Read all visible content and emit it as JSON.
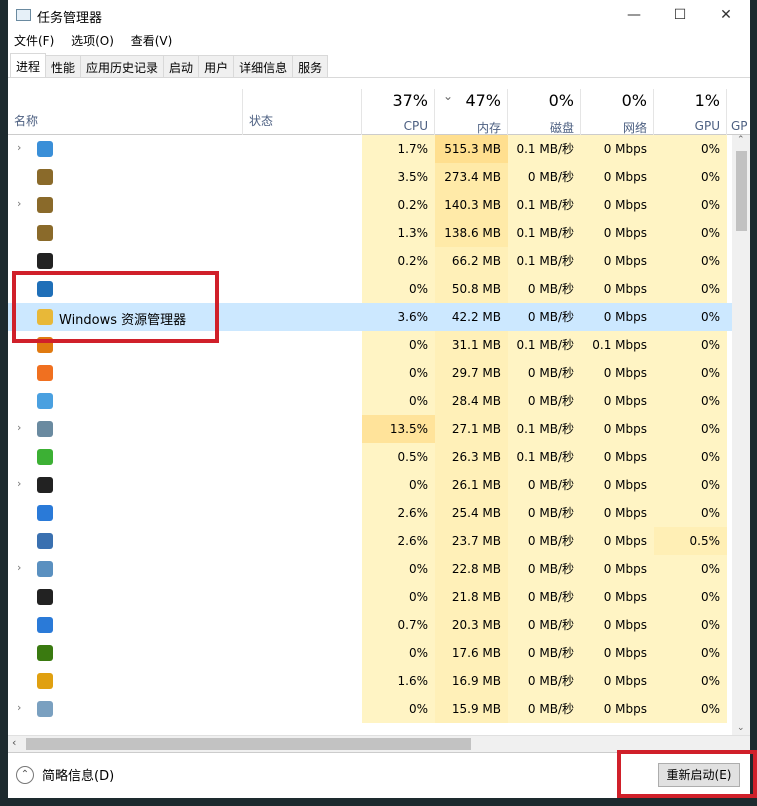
{
  "window": {
    "title": "任务管理器",
    "minimize": "—",
    "maximize": "☐",
    "close": "✕"
  },
  "menu": [
    "文件(F)",
    "选项(O)",
    "查看(V)"
  ],
  "tabs": [
    "进程",
    "性能",
    "应用历史记录",
    "启动",
    "用户",
    "详细信息",
    "服务"
  ],
  "active_tab": 0,
  "columns": {
    "name": "名称",
    "status": "状态",
    "cpu": {
      "pct": "37%",
      "label": "CPU"
    },
    "mem": {
      "pct": "47%",
      "label": "内存",
      "sorted": "⌄"
    },
    "disk": {
      "pct": "0%",
      "label": "磁盘"
    },
    "net": {
      "pct": "0%",
      "label": "网络"
    },
    "gpu": {
      "pct": "1%",
      "label": "GPU"
    },
    "gpu_engine": "GP"
  },
  "rows": [
    {
      "expand": true,
      "icon": "browser-cloud-icon",
      "color": "#3a8fd8",
      "name": "",
      "v": [
        "1.7%",
        "515.3 MB",
        "0.1 MB/秒",
        "0 Mbps",
        "0%"
      ]
    },
    {
      "expand": false,
      "icon": "league-of-legends-icon",
      "color": "#8a6a2a",
      "name": "",
      "v": [
        "3.5%",
        "273.4 MB",
        "0 MB/秒",
        "0 Mbps",
        "0%"
      ]
    },
    {
      "expand": true,
      "icon": "league-of-legends-icon",
      "color": "#8a6a2a",
      "name": "",
      "v": [
        "0.2%",
        "140.3 MB",
        "0.1 MB/秒",
        "0 Mbps",
        "0%"
      ]
    },
    {
      "expand": false,
      "icon": "league-of-legends-icon",
      "color": "#8a6a2a",
      "name": "",
      "v": [
        "1.3%",
        "138.6 MB",
        "0.1 MB/秒",
        "0 Mbps",
        "0%"
      ]
    },
    {
      "expand": false,
      "icon": "qq-penguin-icon",
      "color": "#222222",
      "name": "",
      "v": [
        "0.2%",
        "66.2 MB",
        "0.1 MB/秒",
        "0 Mbps",
        "0%"
      ]
    },
    {
      "expand": false,
      "icon": "tp-icon",
      "color": "#1f6fb8",
      "name": "",
      "v": [
        "0%",
        "50.8 MB",
        "0 MB/秒",
        "0 Mbps",
        "0%"
      ]
    },
    {
      "expand": false,
      "icon": "folder-explorer-icon",
      "color": "#e8b838",
      "name": "Windows 资源管理器",
      "selected": true,
      "v": [
        "3.6%",
        "42.2 MB",
        "0 MB/秒",
        "0 Mbps",
        "0%"
      ]
    },
    {
      "expand": false,
      "icon": "orange-c-icon",
      "color": "#e07a10",
      "name": "",
      "v": [
        "0%",
        "31.1 MB",
        "0.1 MB/秒",
        "0.1 Mbps",
        "0%"
      ]
    },
    {
      "expand": false,
      "icon": "orange-g-icon",
      "color": "#f07020",
      "name": "",
      "v": [
        "0%",
        "29.7 MB",
        "0 MB/秒",
        "0 Mbps",
        "0%"
      ]
    },
    {
      "expand": false,
      "icon": "qt-icon",
      "color": "#4aa0e0",
      "name": "",
      "v": [
        "0%",
        "28.4 MB",
        "0 MB/秒",
        "0 Mbps",
        "0%"
      ]
    },
    {
      "expand": true,
      "icon": "monitor-icon",
      "color": "#6a8aa0",
      "name": "",
      "v": [
        "13.5%",
        "27.1 MB",
        "0.1 MB/秒",
        "0 Mbps",
        "0%"
      ]
    },
    {
      "expand": false,
      "icon": "wechat-icon",
      "color": "#3cb034",
      "name": "",
      "v": [
        "0.5%",
        "26.3 MB",
        "0.1 MB/秒",
        "0 Mbps",
        "0%"
      ]
    },
    {
      "expand": true,
      "icon": "black-window-icon",
      "color": "#222222",
      "name": "",
      "v": [
        "0%",
        "26.1 MB",
        "0 MB/秒",
        "0 Mbps",
        "0%"
      ]
    },
    {
      "expand": false,
      "icon": "shield-icon",
      "color": "#2a7ad8",
      "name": "",
      "v": [
        "2.6%",
        "25.4 MB",
        "0 MB/秒",
        "0 Mbps",
        "0%"
      ]
    },
    {
      "expand": false,
      "icon": "window-icon",
      "color": "#3a70b0",
      "name": "",
      "v": [
        "2.6%",
        "23.7 MB",
        "0 MB/秒",
        "0 Mbps",
        "0.5%"
      ]
    },
    {
      "expand": true,
      "icon": "gear-icon",
      "color": "#5a90c0",
      "name": "",
      "v": [
        "0%",
        "22.8 MB",
        "0 MB/秒",
        "0 Mbps",
        "0%"
      ]
    },
    {
      "expand": false,
      "icon": "qq-penguin-icon",
      "color": "#222222",
      "name": "",
      "v": [
        "0%",
        "21.8 MB",
        "0 MB/秒",
        "0 Mbps",
        "0%"
      ]
    },
    {
      "expand": false,
      "icon": "shield-icon",
      "color": "#2a7ad8",
      "name": "",
      "v": [
        "0.7%",
        "20.3 MB",
        "0 MB/秒",
        "0 Mbps",
        "0%"
      ]
    },
    {
      "expand": false,
      "icon": "nvidia-icon",
      "color": "#3a7a10",
      "name": "",
      "v": [
        "0%",
        "17.6 MB",
        "0 MB/秒",
        "0 Mbps",
        "0%"
      ]
    },
    {
      "expand": false,
      "icon": "orange-c-icon",
      "color": "#e0a010",
      "name": "",
      "v": [
        "1.6%",
        "16.9 MB",
        "0 MB/秒",
        "0 Mbps",
        "0%"
      ]
    },
    {
      "expand": true,
      "icon": "paint-palette-icon",
      "color": "#7aa0c0",
      "name": "",
      "v": [
        "0%",
        "15.9 MB",
        "0 MB/秒",
        "0 Mbps",
        "0%"
      ]
    }
  ],
  "footer": {
    "fewer_details": "简略信息(D)",
    "restart": "重新启动(E)"
  }
}
